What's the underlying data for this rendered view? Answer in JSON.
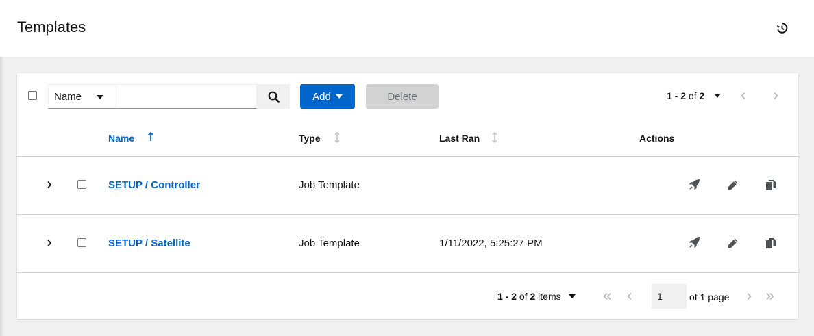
{
  "header": {
    "title": "Templates",
    "history_icon": "history-icon"
  },
  "toolbar": {
    "filter_select_value": "Name",
    "search_placeholder": "",
    "search_value": "",
    "add_label": "Add",
    "delete_label": "Delete",
    "pagination_range": "1 - 2",
    "pagination_of": "of",
    "pagination_total": "2"
  },
  "table": {
    "columns": [
      {
        "label": "Name",
        "sortable": true,
        "sort": "ascending"
      },
      {
        "label": "Type",
        "sortable": true,
        "sort": "none"
      },
      {
        "label": "Last Ran",
        "sortable": true,
        "sort": "none"
      },
      {
        "label": "Actions",
        "sortable": false,
        "sort": "none"
      }
    ],
    "rows": [
      {
        "name": "SETUP / Controller",
        "type": "Job Template",
        "last_ran": "",
        "actions": [
          "launch-icon",
          "edit-icon",
          "copy-icon"
        ]
      },
      {
        "name": "SETUP / Satellite",
        "type": "Job Template",
        "last_ran": "1/11/2022, 5:25:27 PM",
        "actions": [
          "launch-icon",
          "edit-icon",
          "copy-icon"
        ]
      }
    ]
  },
  "footer": {
    "range": "1 - 2",
    "of": "of",
    "total": "2",
    "items_label": "items",
    "page_value": "1",
    "of_pages": "of 1 page"
  },
  "colors": {
    "primary": "#0066cc",
    "page_bg": "#f0f0f0",
    "disabled_bg": "#d2d2d2",
    "text": "#151515"
  }
}
